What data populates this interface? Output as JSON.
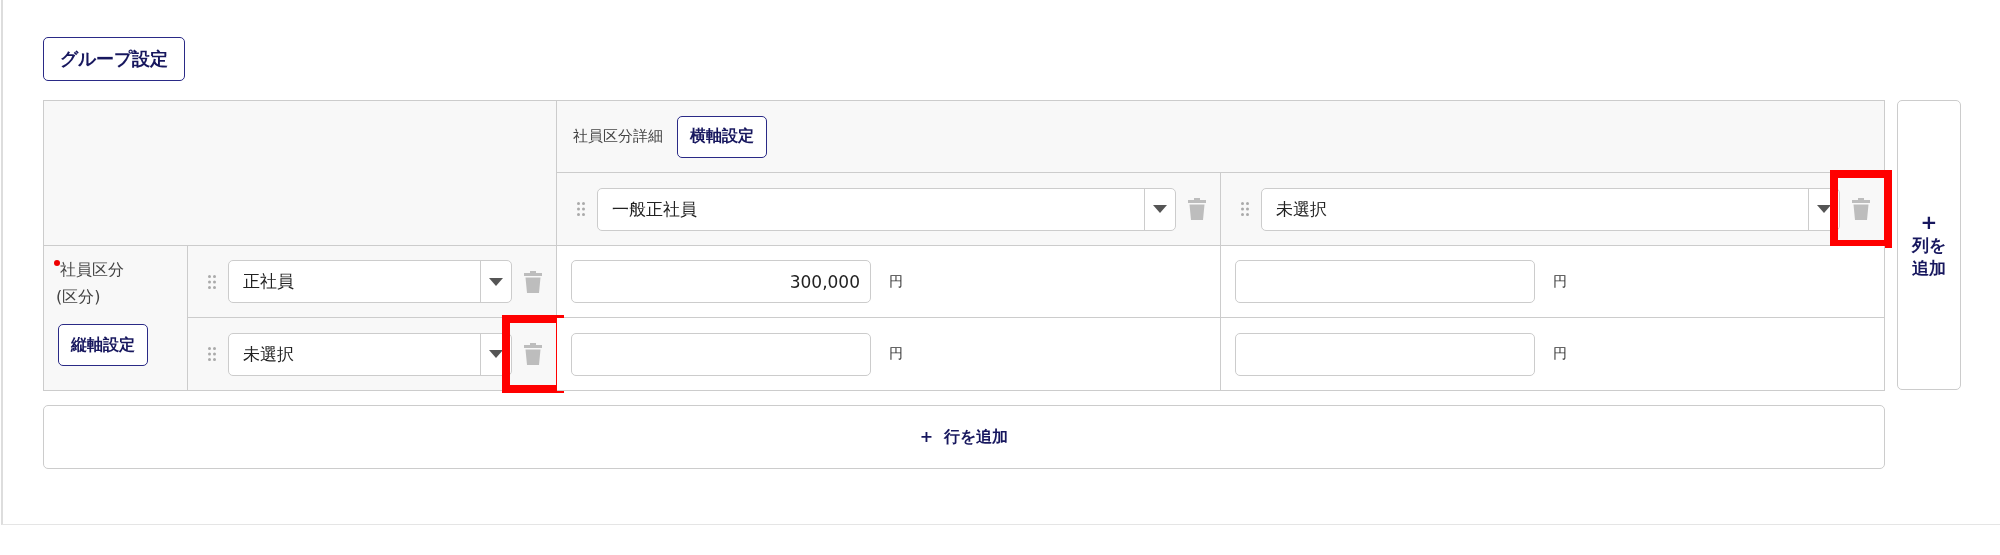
{
  "group_button": "グループ設定",
  "header": {
    "label": "社員区分詳細",
    "button": "横軸設定"
  },
  "columns": [
    {
      "value": "一般正社員",
      "highlighted": false
    },
    {
      "value": "未選択",
      "highlighted": true
    }
  ],
  "row_header": {
    "label": "社員区分",
    "sub": "(区分)",
    "required": true,
    "button": "縦軸設定"
  },
  "rows": [
    {
      "value": "正社員",
      "highlighted": false,
      "cells": [
        {
          "value": "300,000",
          "unit": "円"
        },
        {
          "unit": "円"
        }
      ]
    },
    {
      "value": "未選択",
      "highlighted": true,
      "cells": [
        {
          "unit": "円"
        },
        {
          "unit": "円"
        }
      ]
    }
  ],
  "add_column": {
    "icon": "+",
    "label": "列を追加"
  },
  "add_row": {
    "icon": "+",
    "label": "行を追加"
  }
}
